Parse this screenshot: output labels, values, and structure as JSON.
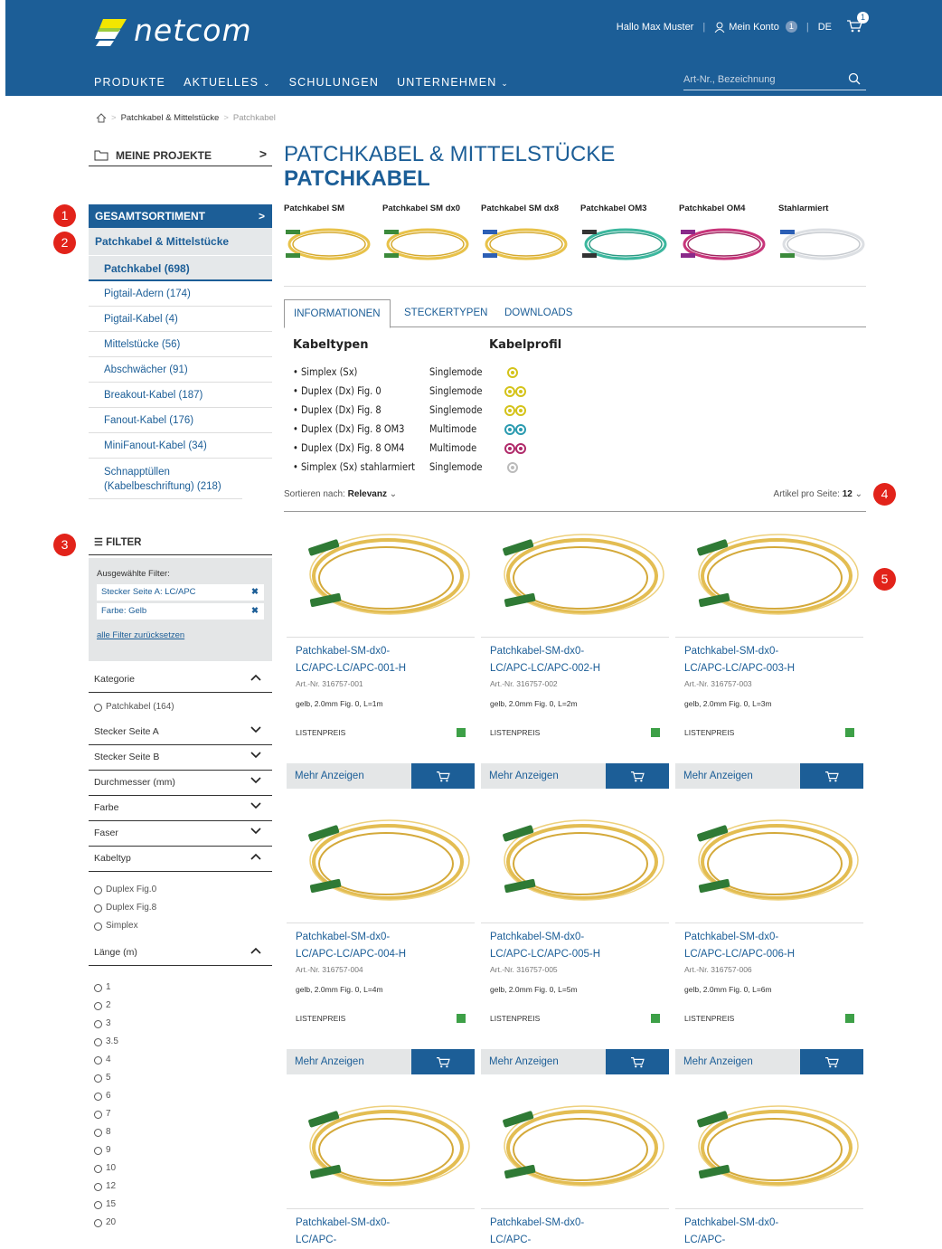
{
  "header": {
    "brand": "netcom",
    "greeting": "Hallo Max Muster",
    "account": "Mein Konto",
    "account_badge": "1",
    "lang": "DE",
    "cart_badge": "1",
    "nav": [
      "PRODUKTE",
      "AKTUELLES",
      "SCHULUNGEN",
      "UNTERNEHMEN"
    ],
    "search_placeholder": "Art-Nr., Bezeichnung",
    "colors": {
      "primary": "#1c5e97",
      "marker": "#e2231a",
      "instock": "#3da047"
    }
  },
  "breadcrumb": [
    "Patchkabel & Mittelstücke",
    "Patchkabel"
  ],
  "projects_label": "MEINE PROJEKTE",
  "title": {
    "line1": "PATCHKABEL & MITTELSTÜCKE",
    "line2": "PATCHKABEL"
  },
  "markers": [
    "1",
    "2",
    "3",
    "4",
    "5"
  ],
  "categories": {
    "head": "GESAMTSORTIMENT",
    "parent": "Patchkabel & Mittelstücke",
    "active": "Patchkabel (698)",
    "items": [
      "Pigtail-Adern (174)",
      "Pigtail-Kabel (4)",
      "Mittelstücke (56)",
      "Abschwächer (91)",
      "Breakout-Kabel (187)",
      "Fanout-Kabel (176)",
      "MiniFanout-Kabel (34)",
      "Schnapptüllen (Kabelbeschriftung) (218)"
    ]
  },
  "filter": {
    "title": "FILTER",
    "selected_label": "Ausgewählte Filter:",
    "chips": [
      "Stecker Seite A: LC/APC",
      "Farbe: Gelb"
    ],
    "reset": "alle Filter zurücksetzen"
  },
  "facets": {
    "kategorie": "Kategorie",
    "kategorie_options": [
      "Patchkabel (164)"
    ],
    "collapsed": [
      "Stecker Seite A",
      "Stecker Seite B",
      "Durchmesser (mm)",
      "Farbe",
      "Faser"
    ],
    "kabeltyp": "Kabeltyp",
    "kabeltyp_options": [
      "Duplex Fig.0",
      "Duplex Fig.8",
      "Simplex"
    ],
    "laenge": "Länge (m)",
    "laenge_options": [
      "1",
      "2",
      "3",
      "3.5",
      "4",
      "5",
      "6",
      "7",
      "8",
      "9",
      "10",
      "12",
      "15",
      "20"
    ]
  },
  "types": [
    "Patchkabel SM",
    "Patchkabel SM dx0",
    "Patchkabel SM dx8",
    "Patchkabel OM3",
    "Patchkabel OM4",
    "Stahlarmiert"
  ],
  "tabs": [
    "INFORMATIONEN",
    "STECKERTYPEN",
    "DOWNLOADS"
  ],
  "info": {
    "h1": "Kabeltypen",
    "h2": "Kabelprofil",
    "rows": [
      {
        "type": "• Simplex (Sx)",
        "mode": "Singlemode",
        "color": "#d4c31a",
        "dual": false
      },
      {
        "type": "• Duplex  (Dx) Fig. 0",
        "mode": "Singlemode",
        "color": "#d4c31a",
        "dual": true
      },
      {
        "type": "• Duplex  (Dx) Fig. 8",
        "mode": "Singlemode",
        "color": "#d4c31a",
        "dual": true
      },
      {
        "type": "• Duplex  (Dx) Fig. 8 OM3",
        "mode": "Multimode",
        "color": "#2b9bb0",
        "dual": true
      },
      {
        "type": "• Duplex  (Dx) Fig. 8 OM4",
        "mode": "Multimode",
        "color": "#b02a6a",
        "dual": true
      },
      {
        "type": "• Simplex (Sx) stahlarmiert",
        "mode": "Singlemode",
        "color": "#bbbbbb",
        "dual": false
      }
    ]
  },
  "sort": {
    "label": "Sortieren nach:",
    "value": "Relevanz",
    "per_page_label": "Artikel pro Seite:",
    "per_page": "12"
  },
  "products": [
    {
      "name": "Patchkabel-SM-dx0-LC/APC-LC/APC-001-H",
      "art": "Art.-Nr. 316757-001",
      "desc": "gelb, 2.0mm Fig. 0, L=1m"
    },
    {
      "name": "Patchkabel-SM-dx0-LC/APC-LC/APC-002-H",
      "art": "Art.-Nr. 316757-002",
      "desc": "gelb, 2.0mm Fig. 0, L=2m"
    },
    {
      "name": "Patchkabel-SM-dx0-LC/APC-LC/APC-003-H",
      "art": "Art.-Nr. 316757-003",
      "desc": "gelb, 2.0mm Fig. 0, L=3m"
    },
    {
      "name": "Patchkabel-SM-dx0-LC/APC-LC/APC-004-H",
      "art": "Art.-Nr. 316757-004",
      "desc": "gelb, 2.0mm Fig. 0, L=4m"
    },
    {
      "name": "Patchkabel-SM-dx0-LC/APC-LC/APC-005-H",
      "art": "Art.-Nr. 316757-005",
      "desc": "gelb, 2.0mm Fig. 0, L=5m"
    },
    {
      "name": "Patchkabel-SM-dx0-LC/APC-LC/APC-006-H",
      "art": "Art.-Nr. 316757-006",
      "desc": "gelb, 2.0mm Fig. 0, L=6m"
    },
    {
      "name": "Patchkabel-SM-dx0-LC/APC-",
      "art": "",
      "desc": ""
    },
    {
      "name": "Patchkabel-SM-dx0-LC/APC-",
      "art": "",
      "desc": ""
    },
    {
      "name": "Patchkabel-SM-dx0-LC/APC-",
      "art": "",
      "desc": ""
    }
  ],
  "card": {
    "price_label": "LISTENPREIS",
    "more_label": "Mehr Anzeigen"
  }
}
